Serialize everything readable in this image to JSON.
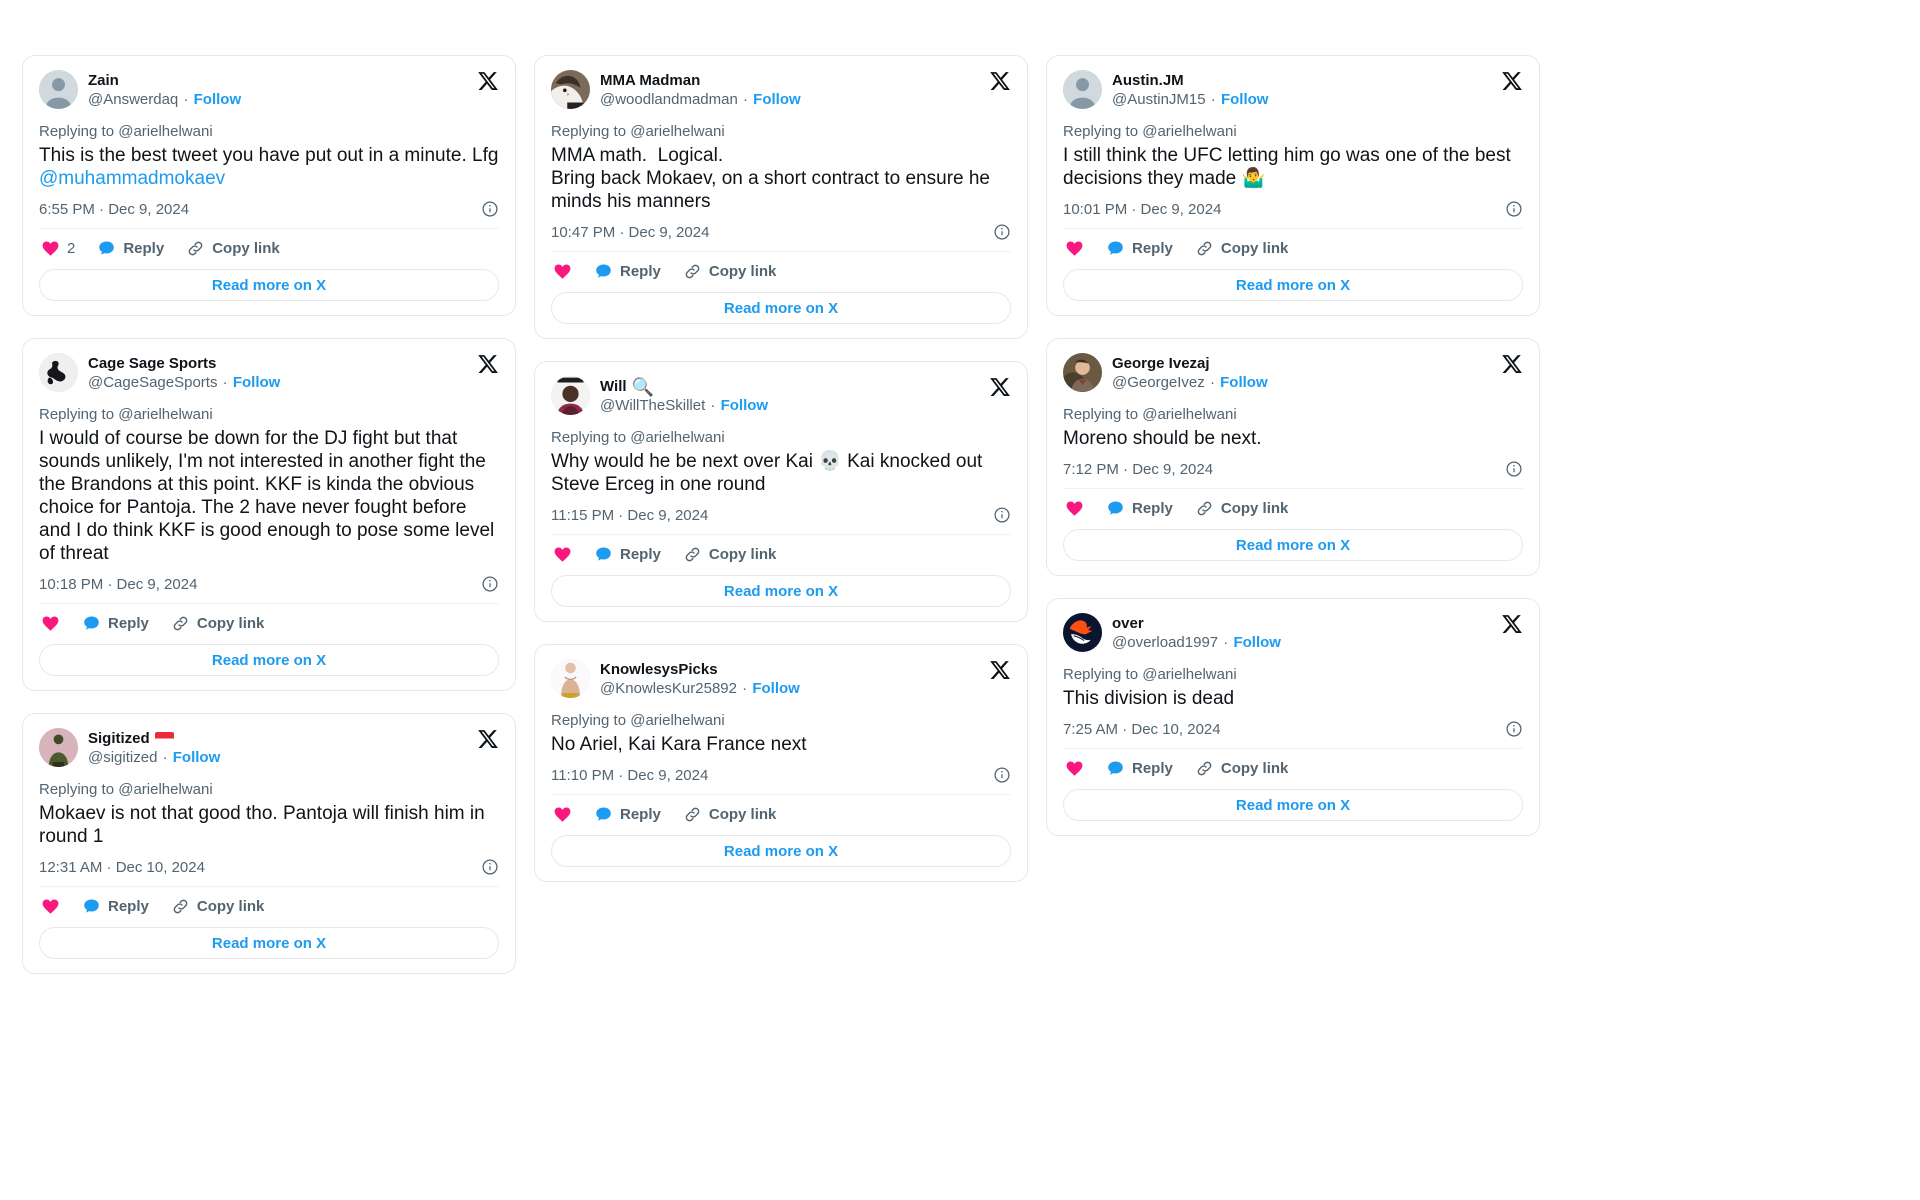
{
  "labels": {
    "replying_prefix": "Replying to",
    "reply_to_handle": "@arielhelwani",
    "follow": "Follow",
    "reply": "Reply",
    "copy_link": "Copy link",
    "read_more": "Read more on X",
    "separator": "·"
  },
  "colors": {
    "link": "#1d9bf0",
    "heart": "#f91880",
    "muted": "#536471",
    "text": "#0f1419",
    "border": "#e6e9ea"
  },
  "icons": {
    "x_logo": "x-logo-icon",
    "info": "info-icon",
    "heart": "heart-icon",
    "reply_bubble": "reply-bubble-icon",
    "copy_link": "link-chain-icon"
  },
  "columns": [
    {
      "id": "column-left",
      "tweets": [
        {
          "id": "tweet-zain",
          "display_name": "Zain",
          "name_emoji": "",
          "handle": "@Answerdaq",
          "avatar": "default-avatar",
          "replying_to": "@arielhelwani",
          "text": "This is the best tweet you have put out in a minute. Lfg ",
          "mention": "@muhammadmokaev",
          "timestamp": "6:55 PM · Dec 9, 2024",
          "like_count": "2"
        },
        {
          "id": "tweet-cagesage",
          "display_name": "Cage Sage Sports",
          "name_emoji": "",
          "handle": "@CageSageSports",
          "avatar": "wrestler-logo",
          "replying_to": "@arielhelwani",
          "text": "I would of course be down for the DJ fight but that sounds unlikely, I'm not interested in another fight the the Brandons at this point. KKF is kinda the obvious choice for Pantoja. The 2 have never fought before and I do think KKF is good enough to pose some level of threat",
          "mention": "",
          "timestamp": "10:18 PM · Dec 9, 2024",
          "like_count": ""
        },
        {
          "id": "tweet-sigitized",
          "display_name": "Sigitized",
          "name_emoji": "flag-sg",
          "handle": "@sigitized",
          "avatar": "person-photo",
          "replying_to": "@arielhelwani",
          "text": "Mokaev is not that good tho. Pantoja will finish him in round 1",
          "mention": "",
          "timestamp": "12:31 AM · Dec 10, 2024",
          "like_count": ""
        }
      ]
    },
    {
      "id": "column-middle",
      "tweets": [
        {
          "id": "tweet-mmamadman",
          "display_name": "MMA Madman",
          "name_emoji": "",
          "handle": "@woodlandmadman",
          "avatar": "cat-photo",
          "replying_to": "@arielhelwani",
          "text": "MMA math.  Logical.\nBring back Mokaev, on a short contract to ensure he minds his manners",
          "mention": "",
          "timestamp": "10:47 PM · Dec 9, 2024",
          "like_count": ""
        },
        {
          "id": "tweet-will",
          "display_name": "Will",
          "name_emoji": "🔍",
          "handle": "@WillTheSkillet",
          "avatar": "man-photo",
          "replying_to": "@arielhelwani",
          "text": "Why would he be next over Kai 💀 Kai knocked out Steve Erceg in one round",
          "mention": "",
          "timestamp": "11:15 PM · Dec 9, 2024",
          "like_count": ""
        },
        {
          "id": "tweet-knowlesys",
          "display_name": "KnowlesysPicks",
          "name_emoji": "",
          "handle": "@KnowlesKur25892",
          "avatar": "fighter-photo",
          "replying_to": "@arielhelwani",
          "text": "No Ariel, Kai Kara France next",
          "mention": "",
          "timestamp": "11:10 PM · Dec 9, 2024",
          "like_count": ""
        }
      ]
    },
    {
      "id": "column-right",
      "tweets": [
        {
          "id": "tweet-austinjm",
          "display_name": "Austin.JM",
          "name_emoji": "",
          "handle": "@AustinJM15",
          "avatar": "default-avatar",
          "replying_to": "@arielhelwani",
          "text": "I still think the UFC letting him go was one of the best decisions they made 🤷‍♂️",
          "mention": "",
          "timestamp": "10:01 PM · Dec 9, 2024",
          "like_count": ""
        },
        {
          "id": "tweet-georgeivezaj",
          "display_name": "George Ivezaj",
          "name_emoji": "",
          "handle": "@GeorgeIvez",
          "avatar": "man-portrait",
          "replying_to": "@arielhelwani",
          "text": "Moreno should be next.",
          "mention": "",
          "timestamp": "7:12 PM · Dec 9, 2024",
          "like_count": ""
        },
        {
          "id": "tweet-over",
          "display_name": "over",
          "name_emoji": "",
          "handle": "@overload1997",
          "avatar": "broncos-logo",
          "replying_to": "@arielhelwani",
          "text": "This division is dead",
          "mention": "",
          "timestamp": "7:25 AM · Dec 10, 2024",
          "like_count": ""
        }
      ]
    }
  ]
}
